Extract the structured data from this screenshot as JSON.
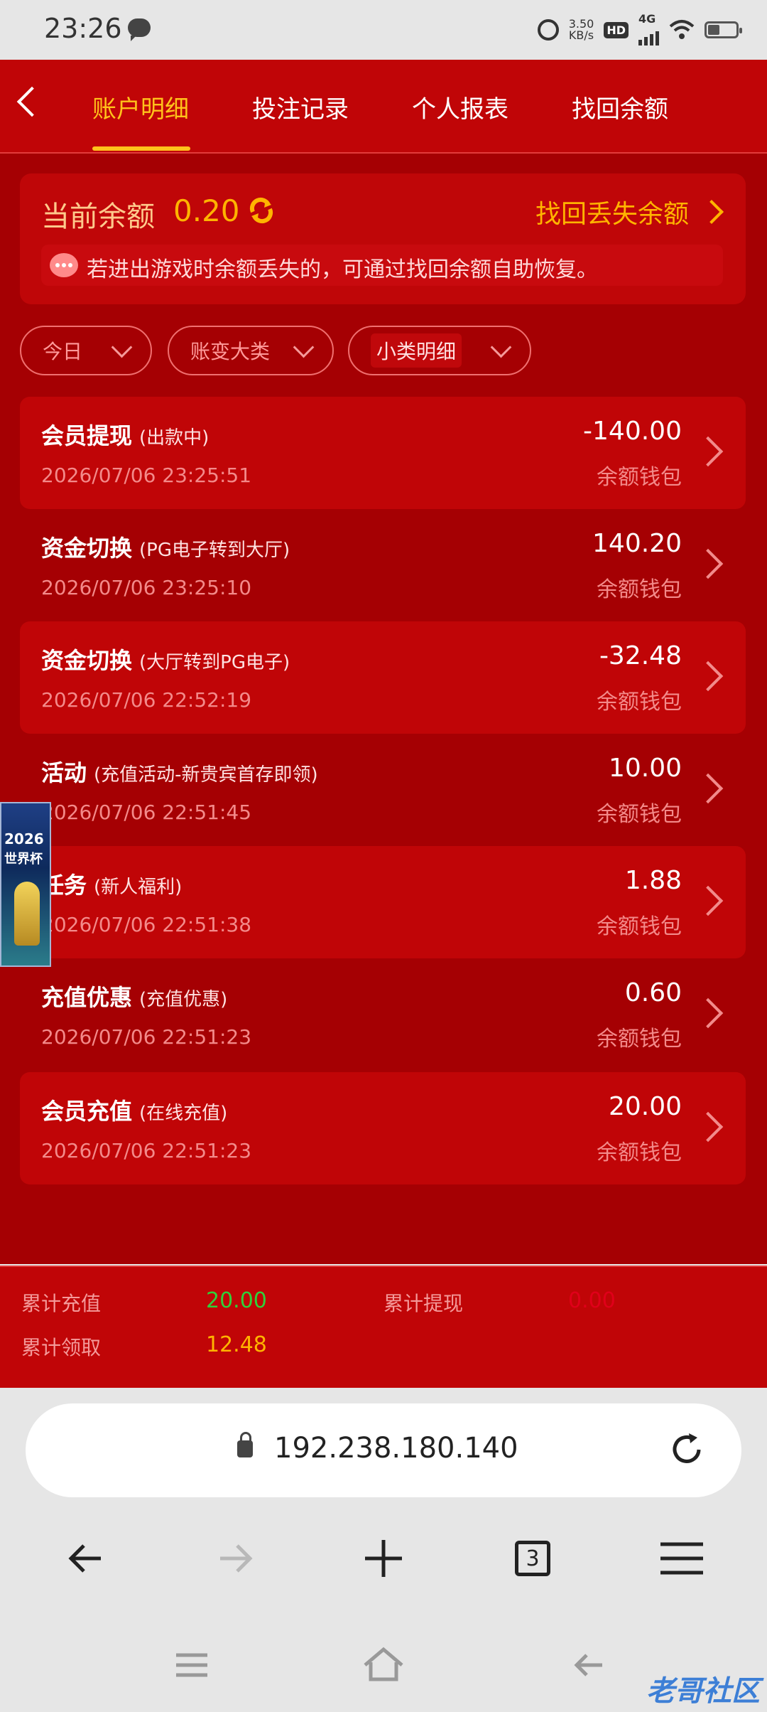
{
  "status_bar": {
    "time": "23:26",
    "speed_top": "3.50",
    "speed_unit": "KB/s",
    "hd": "HD",
    "network": "4G"
  },
  "header": {
    "tabs": [
      {
        "label": "账户明细",
        "active": true
      },
      {
        "label": "投注记录",
        "active": false
      },
      {
        "label": "个人报表",
        "active": false
      },
      {
        "label": "找回余额",
        "active": false
      }
    ]
  },
  "balance": {
    "label": "当前余额",
    "value": "0.20",
    "recover_link": "找回丢失余额",
    "notice": "若进出游戏时余额丢失的，可通过找回余额自助恢复。"
  },
  "filters": [
    {
      "label": "今日"
    },
    {
      "label": "账变大类"
    },
    {
      "label": "小类明细"
    }
  ],
  "transactions": [
    {
      "title": "会员提现",
      "sub": "(出款中)",
      "time": "2026/07/06 23:25:51",
      "amount": "-140.00",
      "wallet": "余额钱包"
    },
    {
      "title": "资金切换",
      "sub": "(PG电子转到大厅)",
      "time": "2026/07/06 23:25:10",
      "amount": "140.20",
      "wallet": "余额钱包"
    },
    {
      "title": "资金切换",
      "sub": "(大厅转到PG电子)",
      "time": "2026/07/06 22:52:19",
      "amount": "-32.48",
      "wallet": "余额钱包"
    },
    {
      "title": "活动",
      "sub": "(充值活动-新贵宾首存即领)",
      "time": "2026/07/06 22:51:45",
      "amount": "10.00",
      "wallet": "余额钱包"
    },
    {
      "title": "任务",
      "sub": "(新人福利)",
      "time": "2026/07/06 22:51:38",
      "amount": "1.88",
      "wallet": "余额钱包"
    },
    {
      "title": "充值优惠",
      "sub": "(充值优惠)",
      "time": "2026/07/06 22:51:23",
      "amount": "0.60",
      "wallet": "余额钱包"
    },
    {
      "title": "会员充值",
      "sub": "(在线充值)",
      "time": "2026/07/06 22:51:23",
      "amount": "20.00",
      "wallet": "余额钱包"
    }
  ],
  "world_cup_badge": {
    "year": "2026",
    "text": "世界杯"
  },
  "summary": {
    "total_deposit_label": "累计充值",
    "total_deposit": "20.00",
    "total_withdraw_label": "累计提现",
    "total_withdraw": "0.00",
    "total_claimed_label": "累计领取",
    "total_claimed": "12.48"
  },
  "browser": {
    "url": "192.238.180.140",
    "tab_count": "3"
  },
  "watermark": "老哥社区",
  "colors": {
    "primary_red": "#c00507",
    "gold": "#ffb400",
    "deposit_green": "#2fd13a",
    "withdraw_red": "#e0001a"
  }
}
